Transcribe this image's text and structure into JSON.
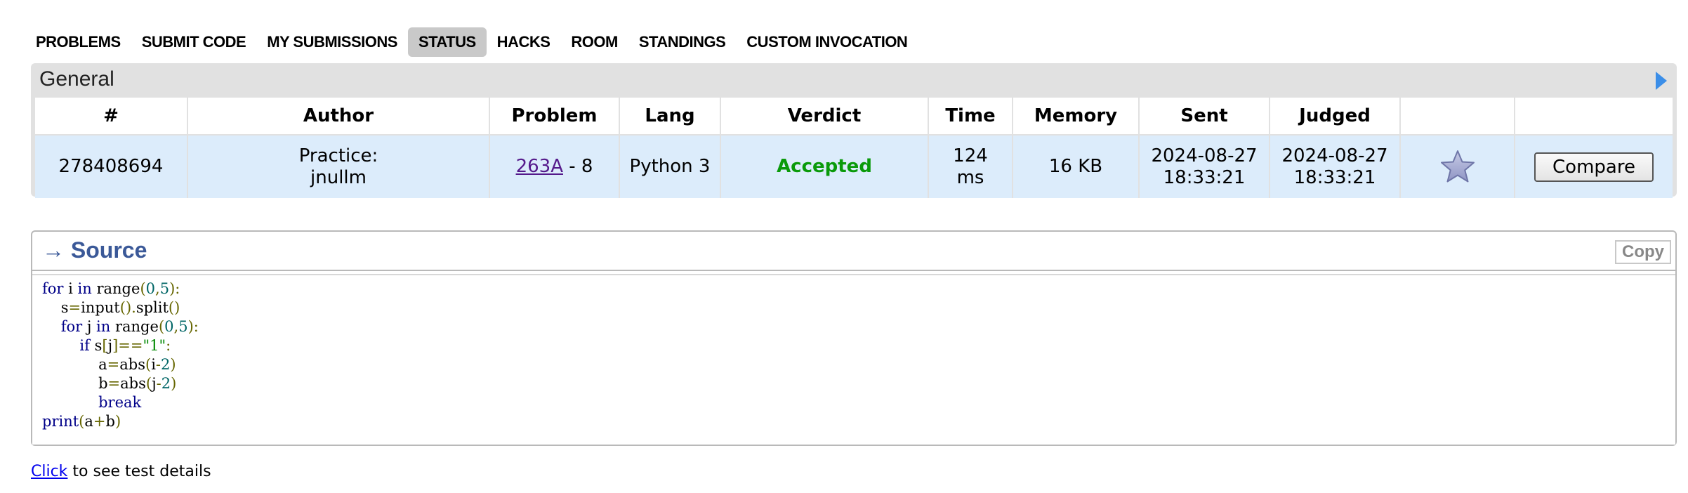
{
  "nav": {
    "items": [
      {
        "label": "PROBLEMS",
        "active": false
      },
      {
        "label": "SUBMIT CODE",
        "active": false
      },
      {
        "label": "MY SUBMISSIONS",
        "active": false
      },
      {
        "label": "STATUS",
        "active": true
      },
      {
        "label": "HACKS",
        "active": false
      },
      {
        "label": "ROOM",
        "active": false
      },
      {
        "label": "STANDINGS",
        "active": false
      },
      {
        "label": "CUSTOM INVOCATION",
        "active": false
      }
    ]
  },
  "general": {
    "title": "General",
    "toggle_icon": "triangle-right-icon",
    "columns": [
      "#",
      "Author",
      "Problem",
      "Lang",
      "Verdict",
      "Time",
      "Memory",
      "Sent",
      "Judged",
      "",
      ""
    ],
    "row": {
      "id": "278408694",
      "author_line1": "Practice:",
      "author_line2": "jnullm",
      "problem_link": "263A",
      "problem_suffix": " - 8",
      "lang": "Python 3",
      "verdict": "Accepted",
      "time_value": "124",
      "time_unit": "ms",
      "memory": "16 KB",
      "sent_date": "2024-08-27",
      "sent_time": "18:33:21",
      "judged_date": "2024-08-27",
      "judged_time": "18:33:21",
      "favorite_icon": "star-icon",
      "compare_label": "Compare"
    },
    "colors": {
      "verdict_accepted": "#0a9a0a",
      "row_bg": "#dcecfb",
      "box_bg": "#e1e1e1"
    }
  },
  "source": {
    "arrow": "→",
    "title": "Source",
    "copy_label": "Copy",
    "code_lines": [
      "for i in range(0,5):",
      "    s=input().split()",
      "    for j in range(0,5):",
      "        if s[j]==\"1\":",
      "            a=abs(i-2)",
      "            b=abs(j-2)",
      "            break",
      "print(a+b)"
    ]
  },
  "footer": {
    "link": "Click",
    "text": " to see test details"
  }
}
